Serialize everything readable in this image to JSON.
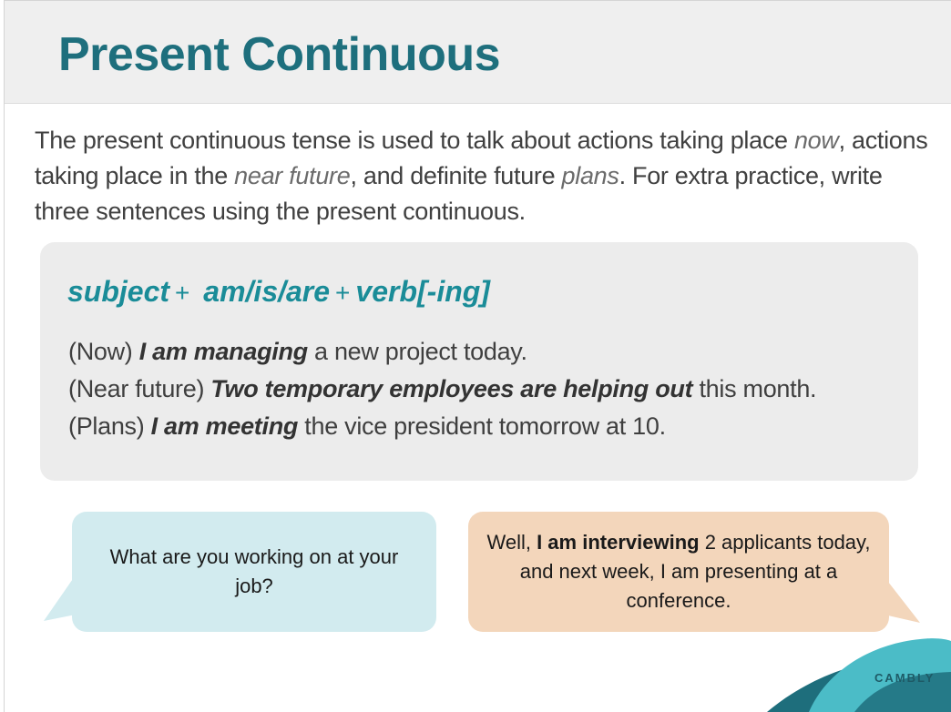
{
  "title": "Present Continuous",
  "intro": {
    "part1": "The present continuous tense is used to talk about actions taking place ",
    "em1": "now",
    "part2": ", actions taking place in the ",
    "em2": "near future",
    "part3": ", and definite future ",
    "em3": "plans",
    "part4": ". For extra practice, write three sentences using the present continuous."
  },
  "formula": {
    "subject": "subject",
    "plus1": "+",
    "verb_be": "am/is/are",
    "plus2": "+",
    "verb_ing": "verb[-ing]"
  },
  "examples": [
    {
      "label": "(Now)",
      "focus": "I am managing",
      "rest": "a new project today."
    },
    {
      "label": "(Near future)",
      "focus": "Two temporary employees are helping out",
      "rest": "this month."
    },
    {
      "label": "(Plans)",
      "focus": "I am meeting",
      "rest": "the vice president tomorrow at 10."
    }
  ],
  "dialogue": {
    "question": "What are you working on at your job?",
    "answer_prefix": "Well, ",
    "answer_focus": "I am interviewing",
    "answer_rest": " 2 applicants today, and next week, I am presenting at a conference."
  },
  "brand": "CAMBLY",
  "colors": {
    "title": "#1e6f7d",
    "formula": "#1a8c98",
    "question_bubble": "#d2ebef",
    "answer_bubble": "#f3d6bb",
    "header_band": "#efefef",
    "formula_box": "#ececec",
    "brand_teal": "#4bbcc7",
    "brand_dark": "#1e6e7c"
  }
}
